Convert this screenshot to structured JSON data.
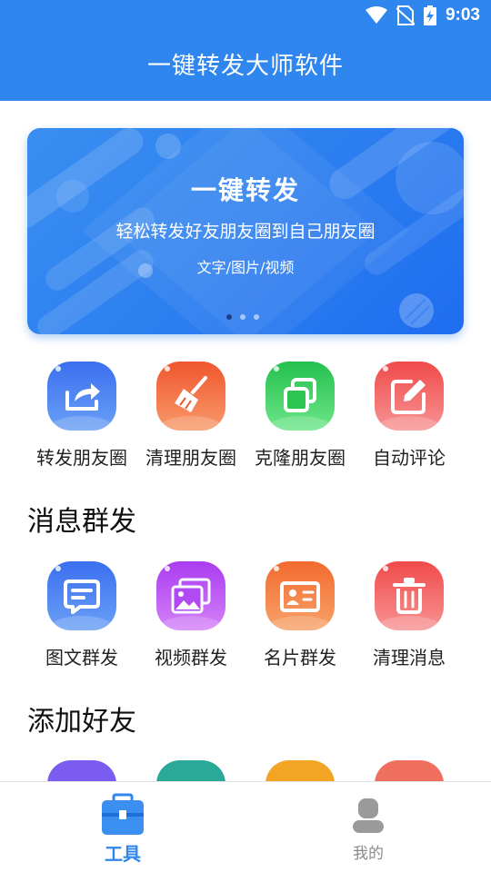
{
  "status_bar": {
    "time": "9:03"
  },
  "header": {
    "title": "一键转发大师软件"
  },
  "banner": {
    "title": "一键转发",
    "subtitle": "轻松转发好友朋友圈到自己朋友圈",
    "tags": "文字/图片/视频",
    "page_count": 3,
    "active_page": 1
  },
  "moments_tools": [
    {
      "label": "转发朋友圈",
      "icon": "share-icon"
    },
    {
      "label": "清理朋友圈",
      "icon": "broom-icon"
    },
    {
      "label": "克隆朋友圈",
      "icon": "copy-icon"
    },
    {
      "label": "自动评论",
      "icon": "edit-icon"
    }
  ],
  "messages": {
    "title": "消息群发",
    "items": [
      {
        "label": "图文群发",
        "icon": "chat-icon"
      },
      {
        "label": "视频群发",
        "icon": "gallery-icon"
      },
      {
        "label": "名片群发",
        "icon": "contact-card-icon"
      },
      {
        "label": "清理消息",
        "icon": "trash-icon"
      }
    ]
  },
  "friends": {
    "title": "添加好友"
  },
  "tab_bar": {
    "tools": "工具",
    "mine": "我的"
  },
  "colors": {
    "primary": "#2f86ee",
    "blue": "#3f7ef2",
    "orange": "#f26a3a",
    "green": "#2fcf5a",
    "red": "#f25a5a",
    "purple": "#b84cf2",
    "orange2": "#f2793a",
    "red2": "#f26464"
  }
}
